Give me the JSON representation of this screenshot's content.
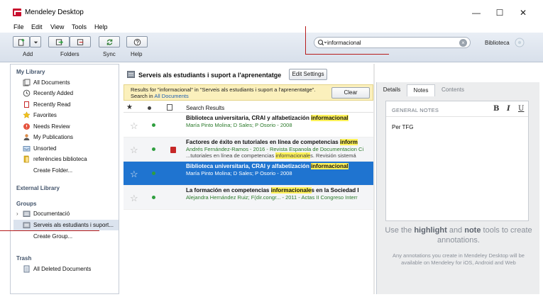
{
  "window": {
    "title": "Mendeley Desktop",
    "minimize": "—",
    "maximize": "☐",
    "close": "✕"
  },
  "menu": [
    "File",
    "Edit",
    "View",
    "Tools",
    "Help"
  ],
  "toolbar": {
    "add_label": "Add",
    "folders_label": "Folders",
    "sync_label": "Sync",
    "help_label": "Help",
    "search_value": "informacional",
    "user_name": "Biblioteca"
  },
  "sidebar": {
    "my_library_header": "My Library",
    "my_library": [
      {
        "label": "All Documents",
        "icon": "documents-icon"
      },
      {
        "label": "Recently Added",
        "icon": "clock-icon"
      },
      {
        "label": "Recently Read",
        "icon": "book-icon"
      },
      {
        "label": "Favorites",
        "icon": "star-icon"
      },
      {
        "label": "Needs Review",
        "icon": "review-icon"
      },
      {
        "label": "My Publications",
        "icon": "person-icon"
      },
      {
        "label": "Unsorted",
        "icon": "tray-icon"
      },
      {
        "label": "referències biblioteca",
        "icon": "folder-icon"
      },
      {
        "label": "Create Folder...",
        "icon": ""
      }
    ],
    "external_header": "External Library",
    "groups_header": "Groups",
    "groups": [
      {
        "label": "Documentació",
        "icon": "group-icon"
      },
      {
        "label": "Serveis als estudiants i suport...",
        "icon": "group-icon"
      },
      {
        "label": "Create Group...",
        "icon": ""
      }
    ],
    "trash_header": "Trash",
    "trash": [
      {
        "label": "All Deleted Documents",
        "icon": "trash-doc-icon"
      }
    ]
  },
  "main": {
    "folder_title": "Serveis als estudiants i suport a l'aprenentatge",
    "edit_settings": "Edit Settings",
    "banner_line1": "Results for \"informacional\" in \"Serveis als estudiants i suport a l'aprenentatge\".",
    "banner_line2_prefix": "Search in ",
    "banner_link": "All Documents",
    "clear_label": "Clear",
    "column_title": "Search Results",
    "rows": [
      {
        "title_before": "Biblioteca universitaria, CRAI y alfabetización ",
        "title_highlight": "informacional",
        "title_after": "",
        "authors": "María Pinto Molina; D Sales; P Osorio - 2008",
        "snippet_before": "",
        "snippet_highlight": "",
        "snippet_after": "",
        "pdf": false
      },
      {
        "title_before": "Factores de éxito en tutoriales en línea de competencias ",
        "title_highlight": "inform",
        "title_after": "",
        "authors": "Andrés Fernández-Ramos - 2016 - Revista Espanola de Documentacion Ci",
        "snippet_before": "...tutoriales en línea de competencias ",
        "snippet_highlight": "informacionale",
        "snippet_after": "s. Revisión sistemá",
        "pdf": true
      },
      {
        "title_before": "Biblioteca universitaria, CRAI y alfabetización ",
        "title_highlight": "informacional",
        "title_after": "",
        "authors": "María Pinto Molina; D Sales; P Osorio - 2008",
        "snippet_before": "",
        "snippet_highlight": "",
        "snippet_after": "",
        "pdf": false
      },
      {
        "title_before": "La formación en competencias ",
        "title_highlight": "informacionale",
        "title_after": "s en la Sociedad I",
        "authors": "Alejandra Hernández Ruiz; F(dir.congr... - 2011 - Actas II Congreso Interr",
        "snippet_before": "",
        "snippet_highlight": "",
        "snippet_after": "",
        "pdf": false
      }
    ],
    "selected_row": 2
  },
  "details": {
    "tabs": [
      "Details",
      "Notes",
      "Contents"
    ],
    "active_tab": "Notes",
    "general_notes_label": "GENERAL NOTES",
    "bold": "B",
    "italic": "I",
    "underline": "U",
    "note_text": "Per TFG",
    "hint_part1": "Use the ",
    "hint_bold1": "highlight",
    "hint_part2": " and ",
    "hint_bold2": "note",
    "hint_part3": " tools to create annotations.",
    "hint_sub": "Any annotations you create in Mendeley Desktop will be available on Mendeley for iOS, Android and Web"
  },
  "colors": {
    "accent": "#1f74d0",
    "banner": "#fbf0bc",
    "highlight": "#fff25a",
    "annotation_line": "#b71c1c"
  }
}
